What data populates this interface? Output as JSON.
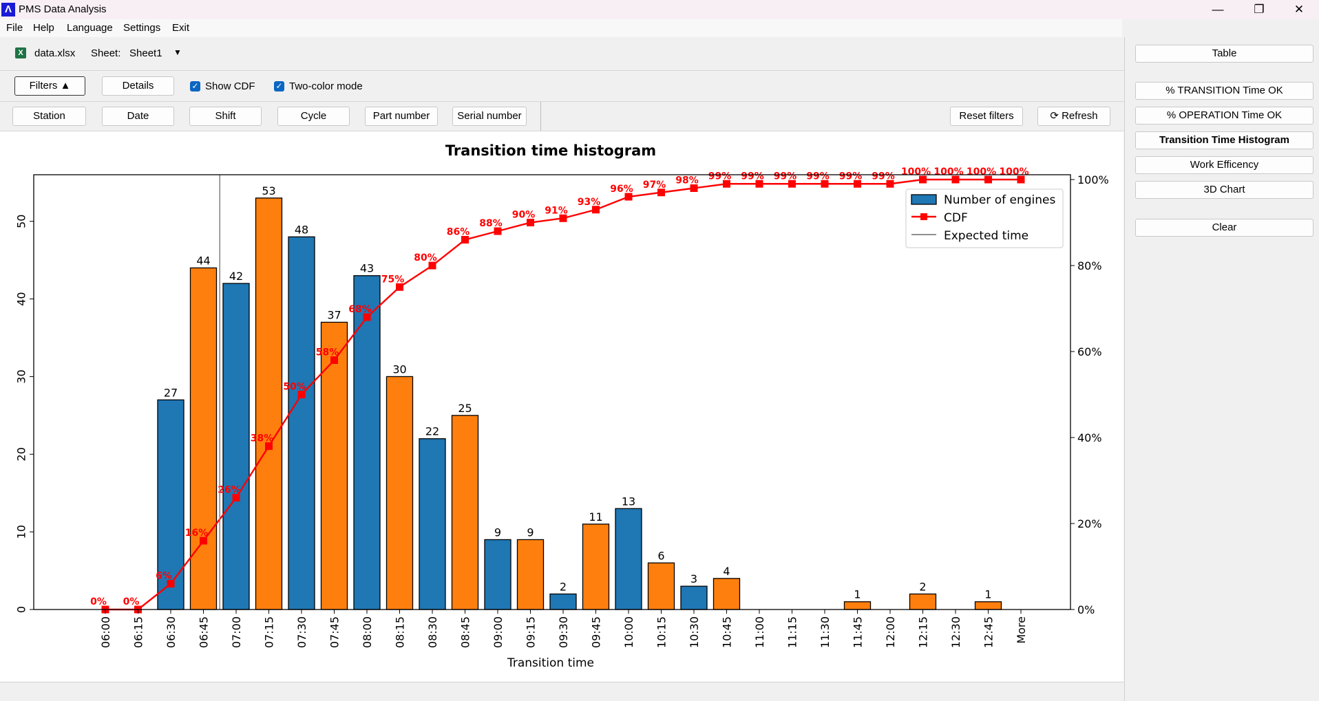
{
  "window": {
    "title": "PMS Data Analysis",
    "minimize": "—",
    "restore": "❐",
    "close": "✕"
  },
  "menu": [
    "File",
    "Help",
    "Language",
    "Settings",
    "Exit"
  ],
  "file": {
    "name": "data.xlsx",
    "sheet_label": "Sheet:",
    "sheet_value": "Sheet1"
  },
  "options": {
    "filters_label": "Filters ▲",
    "details_label": "Details",
    "show_cdf_label": "Show CDF",
    "show_cdf_checked": true,
    "two_color_label": "Two-color mode",
    "two_color_checked": true
  },
  "filters": [
    "Station",
    "Date",
    "Shift",
    "Cycle",
    "Part number",
    "Serial number"
  ],
  "reset_filters_label": "Reset filters",
  "refresh_label": "⟳ Refresh",
  "right_panel": {
    "table": "Table",
    "transition_ok": "% TRANSITION Time OK",
    "operation_ok": "% OPERATION Time OK",
    "histogram": "Transition Time Histogram",
    "work_efficiency": "Work Efficency",
    "chart_3d": "3D Chart",
    "clear": "Clear"
  },
  "colors": {
    "blue": "#1f77b4",
    "orange": "#ff7f0e",
    "cdf": "#ff0000",
    "expected": "#808080"
  },
  "chart_data": {
    "type": "bar",
    "title": "Transition time histogram",
    "xlabel": "Transition time",
    "ylabel": "",
    "categories": [
      "06:00",
      "06:15",
      "06:30",
      "06:45",
      "07:00",
      "07:15",
      "07:30",
      "07:45",
      "08:00",
      "08:15",
      "08:30",
      "08:45",
      "09:00",
      "09:15",
      "09:30",
      "09:45",
      "10:00",
      "10:15",
      "10:30",
      "10:45",
      "11:00",
      "11:15",
      "11:30",
      "11:45",
      "12:00",
      "12:15",
      "12:30",
      "12:45",
      "More"
    ],
    "series": [
      {
        "name": "Number of engines",
        "values": [
          0,
          0,
          27,
          44,
          42,
          53,
          48,
          37,
          43,
          30,
          22,
          25,
          9,
          9,
          2,
          11,
          13,
          6,
          3,
          4,
          0,
          0,
          0,
          1,
          0,
          2,
          0,
          1,
          0
        ]
      },
      {
        "name": "CDF",
        "values": [
          0,
          0,
          6,
          16,
          26,
          38,
          50,
          58,
          68,
          75,
          80,
          86,
          88,
          90,
          91,
          93,
          96,
          97,
          98,
          99,
          99,
          99,
          99,
          99,
          99,
          100,
          100,
          100,
          100
        ]
      }
    ],
    "bar_colors": [
      "orange",
      "orange",
      "blue",
      "orange",
      "blue",
      "orange",
      "blue",
      "orange",
      "blue",
      "orange",
      "blue",
      "orange",
      "blue",
      "orange",
      "blue",
      "orange",
      "blue",
      "orange",
      "blue",
      "orange",
      "blue",
      "orange",
      "blue",
      "orange",
      "blue",
      "orange",
      "blue",
      "orange",
      "blue"
    ],
    "expected_time": "06:45",
    "ylim": [
      0,
      56
    ],
    "yticks": [
      0,
      10,
      20,
      30,
      40,
      50
    ],
    "y2lim": [
      0,
      100
    ],
    "y2ticks": [
      "0%",
      "20%",
      "40%",
      "60%",
      "80%",
      "100%"
    ],
    "legend": [
      "Number of engines",
      "CDF",
      "Expected time"
    ],
    "legend_position": "top-right",
    "grid": false
  }
}
